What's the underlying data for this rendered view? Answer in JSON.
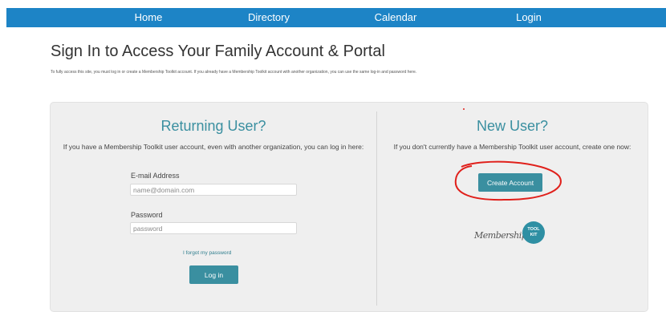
{
  "nav": {
    "items": [
      {
        "label": "Home"
      },
      {
        "label": "Directory"
      },
      {
        "label": "Calendar"
      },
      {
        "label": "Login"
      }
    ],
    "color": "#1d84c6"
  },
  "page": {
    "title": "Sign In to Access Your Family Account & Portal",
    "intro": "To fully access this site, you must log in or create a Membership Toolkit account. If you already have a Membership Toolkit account with another organization, you can use the same log-in and password here."
  },
  "returning": {
    "heading": "Returning User?",
    "description": "If you have a Membership Toolkit user account, even with another organization, you can log in here:",
    "email_label": "E-mail Address",
    "email_placeholder": "name@domain.com",
    "password_label": "Password",
    "password_placeholder": "password",
    "forgot_label": "I forgot my password",
    "login_label": "Log in"
  },
  "new_user": {
    "heading": "New User?",
    "description": "If you don't currently have a Membership Toolkit user account, create one now:",
    "create_label": "Create Account"
  },
  "logo": {
    "script": "Membership",
    "badge_line1": "TOOL",
    "badge_line2": "KIT"
  },
  "colors": {
    "accent": "#3a8fa0",
    "annotation": "#e0201b"
  }
}
